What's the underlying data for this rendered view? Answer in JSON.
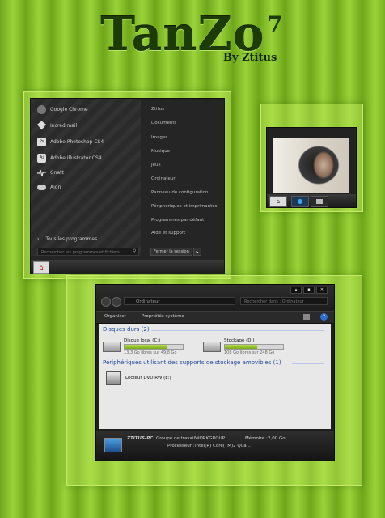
{
  "header": {
    "title": "TanZo",
    "superscript": "7",
    "byline": "By Ztitus"
  },
  "start_menu": {
    "pinned": [
      {
        "label": "Google Chrome",
        "icon": "chrome-icon"
      },
      {
        "label": "Incredimail",
        "icon": "mail-icon"
      },
      {
        "label": "Adobe Photoshop CS4",
        "icon": "photoshop-icon"
      },
      {
        "label": "Adobe Illustrator CS4",
        "icon": "illustrator-icon"
      },
      {
        "label": "Gnatt",
        "icon": "pulse-icon"
      },
      {
        "label": "Aion",
        "icon": "gamepad-icon"
      }
    ],
    "all_programs": "Tous les programmes",
    "search_placeholder": "Rechercher les programmes et fichiers",
    "links": [
      "Ztitus",
      "Documents",
      "Images",
      "Musique",
      "Jeux",
      "Ordinateur",
      "Panneau de configuration",
      "Périphériques et imprimantes",
      "Programmes par défaut",
      "Aide et support"
    ],
    "shutdown_label": "Fermer la session",
    "shutdown_arrow": "▸"
  },
  "preview": {
    "taskbar_buttons": [
      "start-orb",
      "media-player",
      "window"
    ]
  },
  "explorer": {
    "title_buttons": [
      "▴",
      "▪",
      "✕"
    ],
    "address": "Ordinateur",
    "search_placeholder": "Rechercher dans : Ordinateur",
    "toolbar": {
      "organize": "Organiser",
      "system_properties": "Propriétés système"
    },
    "groups": {
      "hard_disks": "Disques durs (2)",
      "removable": "Périphériques utilisant des supports de stockage amovibles (1)"
    },
    "drives": [
      {
        "name": "Disque local (C:)",
        "free": "13,3 Go libres sur 49,8 Go",
        "used_fraction": 0.73
      },
      {
        "name": "Stockage (D:)",
        "free": "108 Go libres sur 248 Go",
        "used_fraction": 0.56
      }
    ],
    "removable_drives": [
      {
        "name": "Lecteur DVD RW (E:)"
      }
    ],
    "details": {
      "pc_name": "ZTITUS-PC",
      "workgroup_label": "Groupe de travail :",
      "workgroup_value": "WORKGROUP",
      "memory_label": "Mémoire :",
      "memory_value": "2,00 Go",
      "cpu_label": "Processeur :",
      "cpu_value": "Intel(R) Core(TM)2 Qua..."
    }
  }
}
